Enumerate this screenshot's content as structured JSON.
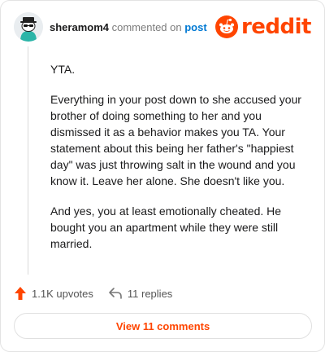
{
  "header": {
    "username": "sheramom4",
    "action_text": "commented on",
    "post_link": "post",
    "logo_text": "reddit"
  },
  "comment": {
    "paragraphs": [
      "YTA.",
      "Everything in your post down to she accused your brother of doing something to her and you dismissed it as a behavior makes you TA. Your statement about this being her father's \"happiest day\" was just throwing salt in the wound and you know it. Leave her alone. She doesn't like you.",
      "And yes, you at least emotionally cheated. He bought you an apartment while they were still married."
    ]
  },
  "actions": {
    "upvotes": "1.1K upvotes",
    "replies": "11 replies"
  },
  "footer": {
    "view_comments": "View 11 comments"
  },
  "colors": {
    "brand": "#ff4500",
    "link": "#0079d3"
  },
  "icons": [
    "avatar",
    "reddit-logo-icon",
    "upvote-icon",
    "reply-icon"
  ]
}
